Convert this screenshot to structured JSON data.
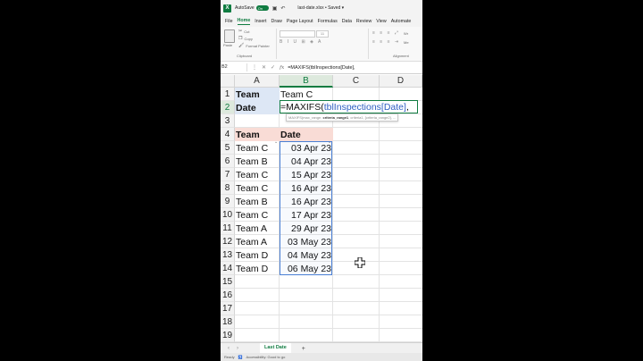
{
  "titlebar": {
    "logo": "X",
    "autosave_label": "AutoSave",
    "toggle_label": "On",
    "filename": "last-date.xlsx • Saved ▾"
  },
  "menu": [
    "File",
    "Home",
    "Insert",
    "Draw",
    "Page Layout",
    "Formulas",
    "Data",
    "Review",
    "View",
    "Automate"
  ],
  "menu_active": "Home",
  "ribbon": {
    "paste_label": "Paste",
    "cut_label": "Cut",
    "copy_label": "Copy",
    "format_painter_label": "Format Painter",
    "clipboard_group": "Clipboard",
    "font_size": "11",
    "wrap_label": "Wr",
    "merge_label": "Me",
    "alignment_group": "Alignment"
  },
  "formula_bar": {
    "name_box": "B2",
    "fx": "fx",
    "formula": "=MAXIFS(tblInspections[Date],"
  },
  "columns": [
    "A",
    "B",
    "C",
    "D"
  ],
  "selected_column": "B",
  "rows": [
    "1",
    "2",
    "3",
    "4",
    "5",
    "6",
    "7",
    "8",
    "9",
    "10",
    "11",
    "12",
    "13",
    "14",
    "15",
    "16",
    "17",
    "18",
    "19"
  ],
  "selected_row": "2",
  "criteria": {
    "a1": "Team",
    "b1": "Team C",
    "a2": "Date"
  },
  "edit_cell": {
    "prefix": "=MAXIFS(",
    "ref": "tblInspections[Date]",
    "suffix": ","
  },
  "tooltip": {
    "fn": "MAXIFS(max_range, ",
    "bold": "criteria_range1",
    "rest": ", criteria1, [criteria_range2], ..."
  },
  "table": {
    "headers": [
      "Team",
      "Date"
    ],
    "rows": [
      [
        "Team C",
        "03 Apr 23"
      ],
      [
        "Team B",
        "04 Apr 23"
      ],
      [
        "Team C",
        "15 Apr 23"
      ],
      [
        "Team C",
        "16 Apr 23"
      ],
      [
        "Team B",
        "16 Apr 23"
      ],
      [
        "Team C",
        "17 Apr 23"
      ],
      [
        "Team A",
        "29 Apr 23"
      ],
      [
        "Team A",
        "03 May 23"
      ],
      [
        "Team D",
        "04 May 23"
      ],
      [
        "Team D",
        "06 May 23"
      ]
    ]
  },
  "sheet_tab": "Last Date",
  "status": {
    "ready": "Ready",
    "accessibility": "Accessibility: Good to go"
  },
  "colors": {
    "accent": "#107c41",
    "criteria_fill": "#dde7f5",
    "header_fill": "#f9dcd6",
    "ref_blue": "#2f5fc2"
  }
}
